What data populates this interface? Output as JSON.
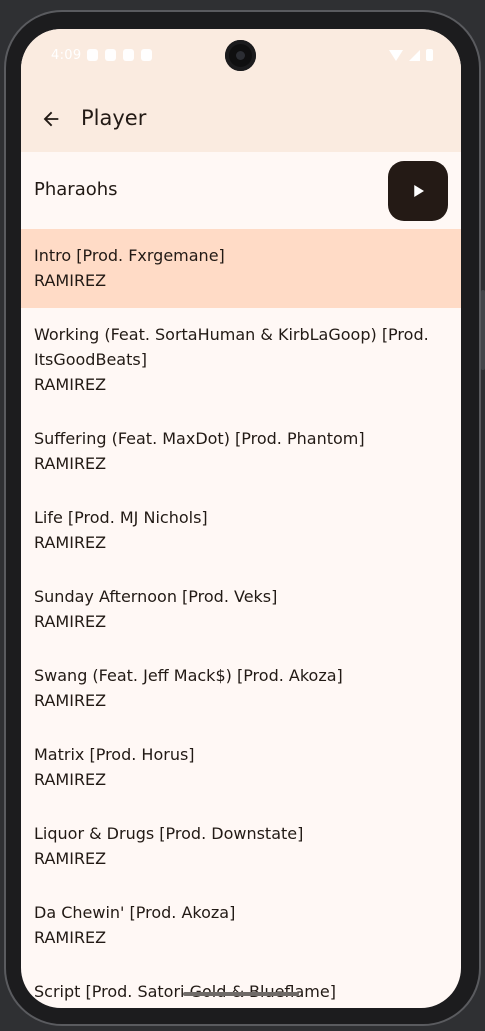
{
  "status_bar": {
    "time": "4:09"
  },
  "app_bar": {
    "title": "Player",
    "back_icon": "arrow-back-icon"
  },
  "album": {
    "title": "Pharaohs",
    "play_icon": "play-icon"
  },
  "tracks": [
    {
      "title": "Intro [Prod. Fxrgemane]",
      "artist": "RAMIREZ",
      "selected": true
    },
    {
      "title": "Working (Feat. SortaHuman & KirbLaGoop) [Prod. ItsGoodBeats]",
      "artist": "RAMIREZ",
      "selected": false
    },
    {
      "title": "Suffering (Feat. MaxDot) [Prod. Phantom]",
      "artist": "RAMIREZ",
      "selected": false
    },
    {
      "title": "Life [Prod. MJ Nichols]",
      "artist": "RAMIREZ",
      "selected": false
    },
    {
      "title": "Sunday Afternoon [Prod. Veks]",
      "artist": "RAMIREZ",
      "selected": false
    },
    {
      "title": "Swang (Feat. Jeff Mack$) [Prod. Akoza]",
      "artist": "RAMIREZ",
      "selected": false
    },
    {
      "title": "Matrix [Prod. Horus]",
      "artist": "RAMIREZ",
      "selected": false
    },
    {
      "title": "Liquor & Drugs [Prod. Downstate]",
      "artist": "RAMIREZ",
      "selected": false
    },
    {
      "title": "Da Chewin' [Prod. Akoza]",
      "artist": "RAMIREZ",
      "selected": false
    },
    {
      "title": "Script [Prod. Satori Gold & Blueflame]",
      "artist": "",
      "selected": false
    }
  ],
  "colors": {
    "app_bar_bg": "#faebe0",
    "surface": "#fff8f5",
    "selected_row": "#ffdbc6",
    "play_button": "#241a15",
    "text": "#221a15"
  }
}
